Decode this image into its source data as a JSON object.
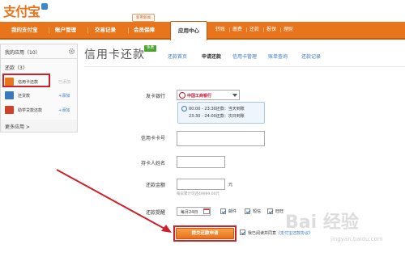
{
  "header": {
    "logo_text": "支付宝",
    "new_badge": "新用新闻",
    "nav_items": [
      "我的支付宝",
      "账户管理",
      "交易记录",
      "会员保障",
      "应用中心"
    ],
    "nav_subitems": [
      "转账",
      "缴费",
      "还款",
      "报保",
      "理财"
    ]
  },
  "sidebar": {
    "title": "我的应用（10）",
    "section": "还款（3）",
    "items": [
      {
        "label": "信用卡还款",
        "action": "已添加",
        "icon_color": "#e8751b",
        "icon": "credit-card-icon"
      },
      {
        "label": "还贷款",
        "action": "+添加",
        "icon_color": "#3a78c2",
        "icon": "loan-icon"
      },
      {
        "label": "助学贷款还款",
        "action": "+添加",
        "icon_color": "#d0402a",
        "icon": "student-loan-icon"
      }
    ],
    "more": "更多应用 >"
  },
  "main": {
    "title": "信用卡还款",
    "title_badge": "免费",
    "tabs": [
      "还款首页",
      "申请还款",
      "信用卡管理",
      "账单查询",
      "还款记录"
    ],
    "active_tab": "申请还款",
    "form": {
      "bank_label": "发卡银行",
      "bank_value": "中国工商银行",
      "time_lines": [
        "00:00 - 23:30还款：当天到账",
        "23:30 - 24:00还款：次日到账"
      ],
      "card_no_label": "信用卡卡号",
      "holder_label": "持卡人姓名",
      "amount_label": "还款金额",
      "amount_unit": "元",
      "amount_hint": "每日累计可还49999.00元",
      "remind_label": "还款提醒",
      "remind_date": "每月24日",
      "remind_options": [
        {
          "label": "邮件",
          "checked": true
        },
        {
          "label": "短信",
          "checked": true
        },
        {
          "label": "旺旺",
          "checked": true
        }
      ],
      "submit_label": "提交还款申请",
      "agree_text": "我已阅读并同意",
      "agree_link": "《支付宝还款协议》"
    }
  },
  "watermark": {
    "text": "Bai 经验",
    "sub": "jingyan.baidu.com"
  },
  "colors": {
    "brand_orange": "#e8751b",
    "highlight_red": "#d0202a",
    "link_blue": "#3a78c2"
  }
}
